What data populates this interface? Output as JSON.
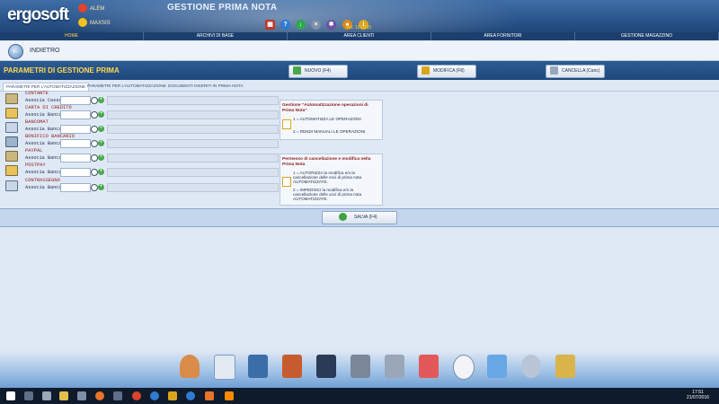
{
  "header": {
    "logo": "ergosoft",
    "users": [
      {
        "name": "ALEM"
      },
      {
        "name": "MAXSIS"
      }
    ],
    "title": "GESTIONE PRIMA NOTA",
    "version": "Ver. 10.0710",
    "icons": [
      "calendar-icon",
      "help-icon",
      "download-icon",
      "close-icon",
      "gear-icon",
      "user-icon",
      "info-icon"
    ]
  },
  "nav": [
    "HOME",
    "ARCHIVI DI BASE",
    "AREA CLIENTI",
    "AREA FORNITORI",
    "GESTIONE MAGAZZINO"
  ],
  "back_label": "INDIETRO",
  "section_title": "PARAMETRI DI GESTIONE PRIMA",
  "toolbar": {
    "new": "NUOVO (F4)",
    "edit": "MODIFICA (F8)",
    "cancel": "CANCELLA (Canc)"
  },
  "tabs": [
    "PARAMETRI PER L'AUTOMATIZZAZIONE",
    "PARAMETRI PER L'AUTOMATIZZAZIONE",
    "DOCUMENTI INSERITI IN PRIMA NOTA"
  ],
  "rows": [
    {
      "name": "CONTANTE",
      "sub": "Associa Cassa"
    },
    {
      "name": "CARTA DI CREDITO",
      "sub": "Associa Banca"
    },
    {
      "name": "BANCOMAT",
      "sub": "Associa Banca"
    },
    {
      "name": "BONIFICO BANCARIO",
      "sub": "Associa Banca"
    },
    {
      "name": "PAYPAL",
      "sub": "Associa Banca"
    },
    {
      "name": "POSTPAY",
      "sub": "Associa Banca"
    },
    {
      "name": "CONTRASSEGNO",
      "sub": "Associa Banca"
    }
  ],
  "panel1": {
    "title": "Gestione \"Automatizzazione operazioni di Prima Nota\"",
    "opt1": "1 = AUTOMATIZZA LE OPERAZIONI",
    "opt2": "2 = RENDI MANUALI LE OPERAZIONI"
  },
  "panel2": {
    "title": "Permesso di cancellazione e modifica nella Prima Nota",
    "opt1": "1 = AUTORIZZA la modifica e/o la cancellazione delle voci di prima nota AUTOMATIZZATE.",
    "opt2": "2 = IMPEDISCI la modifica e/o la cancellazione delle voci di prima nota AUTOMATIZZATE."
  },
  "save_label": "SALVA (F4)",
  "dock": [
    "customer-icon",
    "card-icon",
    "binder-icon",
    "documents-icon",
    "security-icon",
    "disk-icon",
    "printer-icon",
    "calendar-icon",
    "clock-icon",
    "tag-icon",
    "search-icon",
    "tools-icon"
  ],
  "taskbar": {
    "time": "17:51",
    "date": "21/07/2016"
  },
  "colors": {
    "accent": "#ffd84d",
    "header": "#2a558c",
    "label": "#8b1a1a"
  }
}
